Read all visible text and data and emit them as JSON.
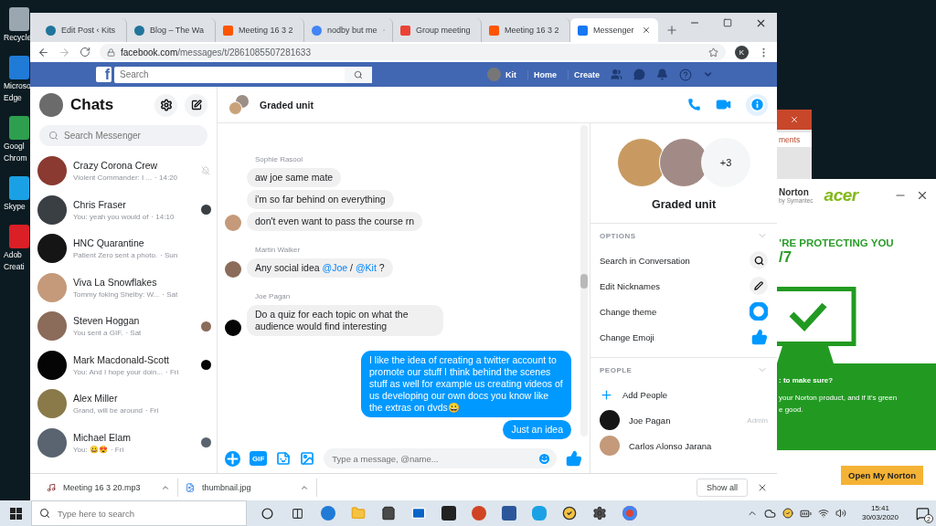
{
  "desktop_icons": [
    {
      "kind": "recycle",
      "lines": [
        "Recycle"
      ]
    },
    {
      "kind": "edge",
      "lines": [
        "Microso",
        "Edge"
      ]
    },
    {
      "kind": "chrome",
      "lines": [
        "Googl",
        "Chrom"
      ]
    },
    {
      "kind": "skype",
      "lines": [
        "Skype"
      ]
    },
    {
      "kind": "adobe",
      "lines": [
        "Adob",
        "Creati"
      ]
    }
  ],
  "browser": {
    "tabs": [
      {
        "title": "Edit Post ‹ Kits",
        "kind": "wordpress",
        "selected": false
      },
      {
        "title": "Blog – The Wa",
        "kind": "wordpress",
        "selected": false
      },
      {
        "title": "Meeting 16 3 2",
        "kind": "soundcloud",
        "selected": false
      },
      {
        "title": "nodby but me",
        "kind": "google",
        "selected": false
      },
      {
        "title": "Group meeting",
        "kind": "gmail",
        "selected": false
      },
      {
        "title": "Meeting 16 3 2",
        "kind": "soundcloud",
        "selected": false
      },
      {
        "title": "Messenger",
        "kind": "facebook",
        "selected": true
      }
    ],
    "address": {
      "host": "facebook.com",
      "path": "/messages/t/2861085507281633"
    },
    "profile_initial": "K"
  },
  "facebook_bar": {
    "logo": "f",
    "search_placeholder": "Search",
    "user_name": "Kit",
    "links": [
      "Home",
      "Create"
    ]
  },
  "chats": {
    "title": "Chats",
    "search_placeholder": "Search Messenger",
    "items": [
      {
        "name": "Crazy Corona Crew",
        "preview": "Violent Commander: I ...",
        "time": "· 14:20",
        "kind": "muted"
      },
      {
        "name": "Chris Fraser",
        "preview": "You: yeah you would of",
        "time": "· 14:10",
        "kind": "seen"
      },
      {
        "name": "HNC Quarantine",
        "preview": "Patient Zero sent a photo.",
        "time": "· Sun",
        "kind": "plain"
      },
      {
        "name": "Viva La Snowflakes",
        "preview": "Tommy foking Shelby: W...",
        "time": "· Sat",
        "kind": "plain"
      },
      {
        "name": "Steven Hoggan",
        "preview": "You sent a GIF.",
        "time": "· Sat",
        "kind": "seen"
      },
      {
        "name": "Mark Macdonald-Scott",
        "preview": "You: And I hope your doin...",
        "time": "· Fri",
        "kind": "seen"
      },
      {
        "name": "Alex Miller",
        "preview": "Grand, will be around",
        "time": "· Fri",
        "kind": "plain"
      },
      {
        "name": "Michael Elam",
        "preview": "You: 😀😍",
        "time": "· Fri",
        "kind": "seen"
      }
    ]
  },
  "conversation": {
    "title": "Graded unit",
    "groups": [
      {
        "sender": "Sophie Rasool",
        "outgoing": false,
        "messages": [
          "aw joe same mate",
          "i'm so far behind on everything",
          "don't even want to pass the course rn"
        ]
      },
      {
        "sender": "Martin Walker",
        "outgoing": false,
        "messages": [
          [
            {
              "text": "Any social idea ",
              "kind": "plain"
            },
            {
              "text": "@Joe",
              "kind": "mention"
            },
            {
              "text": " / ",
              "kind": "plain"
            },
            {
              "text": "@Kit",
              "kind": "mention"
            },
            {
              "text": " ?",
              "kind": "plain"
            }
          ]
        ]
      },
      {
        "sender": "Joe Pagan",
        "outgoing": false,
        "messages": [
          "Do a quiz for each topic on what the audience would find interesting"
        ]
      },
      {
        "outgoing": true,
        "messages": [
          "I like the idea of creating a twitter account to promote our stuff I think behind the scenes stuff as well for example us creating videos of us developing our own docs you know like the extras on dvds😀",
          "Just an idea"
        ]
      }
    ],
    "composer": {
      "gif_label": "GIF",
      "placeholder": "Type a message, @name..."
    }
  },
  "info_panel": {
    "title": "Graded unit",
    "more_members": "+3",
    "options_heading": "OPTIONS",
    "options": [
      {
        "label": "Search in Conversation",
        "kind": "search"
      },
      {
        "label": "Edit Nicknames",
        "kind": "nickname"
      },
      {
        "label": "Change theme",
        "kind": "theme"
      },
      {
        "label": "Change Emoji",
        "kind": "emoji"
      }
    ],
    "people_heading": "PEOPLE",
    "add_people": "Add People",
    "members": [
      {
        "name": "Joe Pagan",
        "role": "Admin"
      },
      {
        "name": "Carlos Alonso Jarana"
      }
    ]
  },
  "downloads": {
    "items": [
      {
        "name": "Meeting 16 3 20.mp3",
        "kind": "audio"
      },
      {
        "name": "thumbnail.jpg",
        "kind": "image"
      }
    ],
    "show_all": "Show all"
  },
  "background_window": {
    "label": "ments"
  },
  "norton_popup": {
    "brand": "Norton",
    "brand_sub": "by Symantec",
    "partner": "acer",
    "headline": "’RE PROTECTING YOU",
    "headline_2": "/7",
    "question": ": to make sure?",
    "body": [
      "your Norton product, and if it's green",
      "e good."
    ],
    "button": "Open My Norton"
  },
  "taskbar": {
    "search_placeholder": "Type here to search",
    "time": "15:41",
    "date": "30/03/2020",
    "notification_count": "2"
  }
}
